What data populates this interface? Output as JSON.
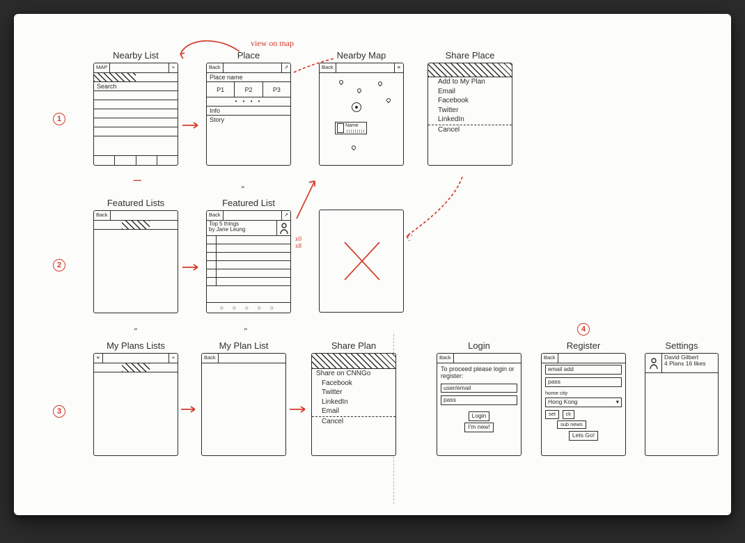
{
  "annotations": {
    "view_on_map": "view on map",
    "row_numbers": [
      "1",
      "2",
      "3",
      "4"
    ],
    "x8": "x0\nx8"
  },
  "screens": {
    "nearby_list": {
      "title": "Nearby List",
      "top_left": "MAP",
      "top_right": "+",
      "search": "Search"
    },
    "place": {
      "title": "Place",
      "back": "Back",
      "action": "↗",
      "name": "Place name",
      "photos": [
        "P1",
        "P2",
        "P3"
      ],
      "dots": "• • • •",
      "info": "Info",
      "story": "Story"
    },
    "nearby_map": {
      "title": "Nearby Map",
      "back": "Back",
      "menu": "≡",
      "callout_name": "Name"
    },
    "share_place": {
      "title": "Share Place",
      "options": [
        "Add to My Plan",
        "Email",
        "Facebook",
        "Twitter",
        "LinkedIn"
      ],
      "cancel": "Cancel"
    },
    "featured_lists": {
      "title": "Featured Lists",
      "back": "Back"
    },
    "featured_list": {
      "title": "Featured List",
      "back": "Back",
      "action": "↗",
      "header_line1": "Top 5 things",
      "header_line2": "by Jane Leung",
      "dots": "○ ○ ○ ○ ○"
    },
    "my_plans_lists": {
      "title": "My Plans Lists",
      "menu": "≡",
      "add": "+"
    },
    "my_plan_list": {
      "title": "My Plan List",
      "back": "Back"
    },
    "share_plan": {
      "title": "Share Plan",
      "header": "Share on CNNGo",
      "options": [
        "Facebook",
        "Twitter",
        "LinkedIn",
        "Email"
      ],
      "cancel": "Cancel"
    },
    "login": {
      "title": "Login",
      "back": "Back",
      "intro": "To proceed please login or register:",
      "user": "user/email",
      "pass": "pass",
      "login_btn": "Login",
      "new_btn": "I'm new!"
    },
    "register": {
      "title": "Register",
      "back": "Back",
      "email": "email add",
      "pass": "pass",
      "home": "home city",
      "home_value": "Hong Kong",
      "sel_btn": "set",
      "sub_btn": "sub news",
      "ck_btn": "ck",
      "go_btn": "Lets Go!"
    },
    "settings": {
      "title": "Settings",
      "name": "David Gilbert",
      "stats": "4 Plans 16 likes"
    }
  }
}
